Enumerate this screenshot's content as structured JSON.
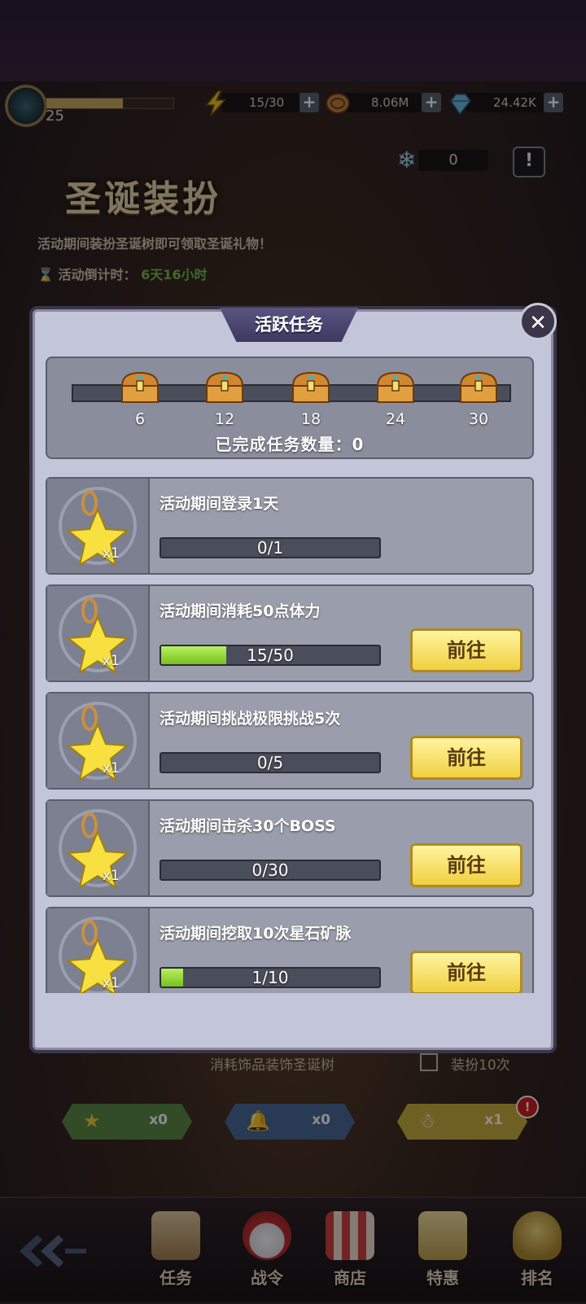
{
  "topbar": {
    "level": "25",
    "xp_fraction": 0.6,
    "stamina": "15/30",
    "gold": "8.06M",
    "diamond": "24.42K",
    "plus_symbol": "+"
  },
  "event": {
    "title": "圣诞装扮",
    "description": "活动期间装扮圣诞树即可领取圣诞礼物！",
    "countdown_label": "活动倒计时：",
    "countdown_value": "6天16小时",
    "snow_count": "0",
    "alert_symbol": "!"
  },
  "modal": {
    "title": "活跃任务",
    "close_symbol": "✕",
    "milestones": [
      "6",
      "12",
      "18",
      "24",
      "30"
    ],
    "completed_label": "已完成任务数量：0",
    "tasks": [
      {
        "title": "活动期间登录1天",
        "progress": "0/1",
        "fraction": 0,
        "reward_count": "x1",
        "has_go": false
      },
      {
        "title": "活动期间消耗50点体力",
        "progress": "15/50",
        "fraction": 0.3,
        "reward_count": "x1",
        "has_go": true
      },
      {
        "title": "活动期间挑战极限挑战5次",
        "progress": "0/5",
        "fraction": 0,
        "reward_count": "x1",
        "has_go": true
      },
      {
        "title": "活动期间击杀30个BOSS",
        "progress": "0/30",
        "fraction": 0,
        "reward_count": "x1",
        "has_go": true
      },
      {
        "title": "活动期间挖取10次星石矿脉",
        "progress": "1/10",
        "fraction": 0.1,
        "reward_count": "x1",
        "has_go": true
      }
    ],
    "go_label": "前往"
  },
  "decorate": {
    "text": "消耗饰品装饰圣诞树",
    "checkbox_label": "装扮10次"
  },
  "items": [
    {
      "count": "x0",
      "icon": "star-icon"
    },
    {
      "count": "x0",
      "icon": "bell-icon"
    },
    {
      "count": "x1",
      "icon": "snowman-icon"
    }
  ],
  "item_badge": "!",
  "nav": {
    "tasks": "任务",
    "battlepass": "战令",
    "shop": "商店",
    "special": "特惠",
    "ranking": "排名"
  },
  "colors": {
    "go_button": "#f0d040",
    "progress_fill": "#9ad840",
    "modal_bg": "#c2c6d8"
  }
}
